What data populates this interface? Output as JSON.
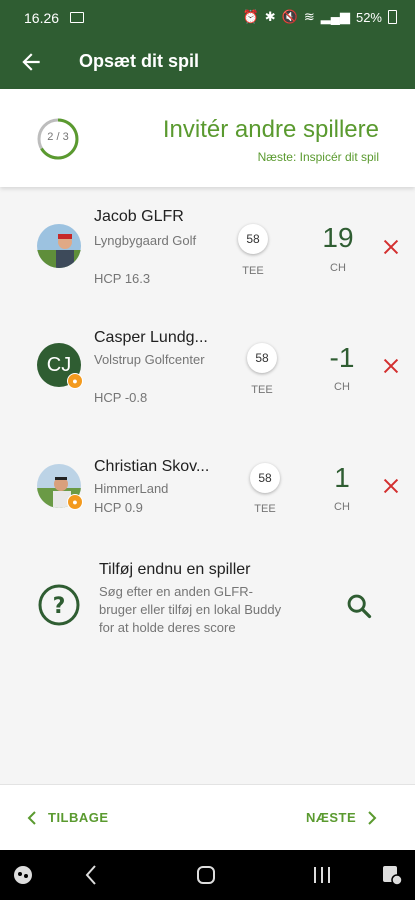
{
  "status": {
    "time": "16.26",
    "battery": "52%"
  },
  "appbar": {
    "title": "Opsæt dit spil"
  },
  "step": {
    "progress": "2 / 3",
    "title": "Invitér andre spillere",
    "next": "Næste: Inspicér dit spil"
  },
  "players": [
    {
      "name": "Jacob GLFR",
      "club": "Lyngbygaard Golf",
      "hcp": "HCP 16.3",
      "tee": "58",
      "tee_label": "TEE",
      "ch": "19",
      "ch_label": "CH"
    },
    {
      "name": "Casper Lundg...",
      "initials": "CJ",
      "club": "Volstrup Golfcenter",
      "hcp": "HCP -0.8",
      "tee": "58",
      "tee_label": "TEE",
      "ch": "-1",
      "ch_label": "CH"
    },
    {
      "name": "Christian Skov...",
      "club": "HimmerLand",
      "hcp": "HCP 0.9",
      "tee": "58",
      "tee_label": "TEE",
      "ch": "1",
      "ch_label": "CH"
    }
  ],
  "add": {
    "title": "Tilføj endnu en spiller",
    "description": "Søg efter en anden GLFR-bruger eller tilføj en lokal Buddy for at holde deres score"
  },
  "bottom": {
    "back": "TILBAGE",
    "next": "NÆSTE"
  },
  "colors": {
    "primary": "#2f5d32",
    "accent": "#5a9a2f",
    "remove": "#d32f2f",
    "badge": "#f39a1e"
  }
}
